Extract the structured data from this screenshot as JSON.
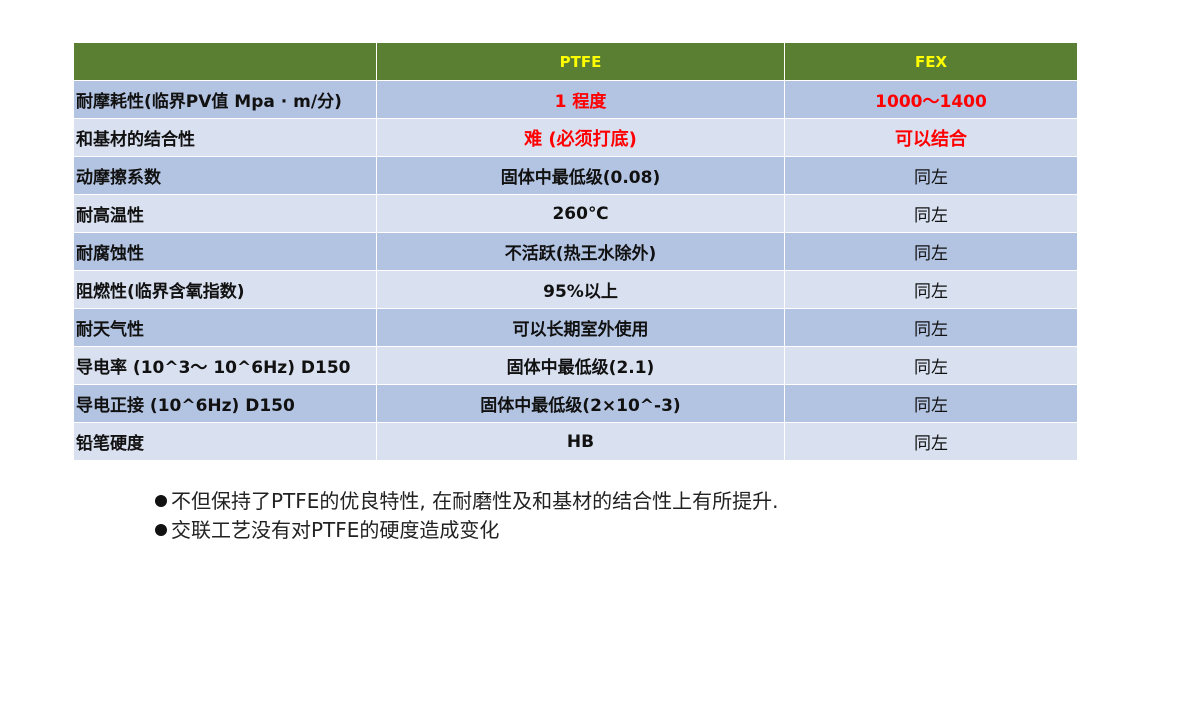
{
  "table": {
    "header": {
      "property": "",
      "ptfe": "PTFE",
      "fex": "FEX"
    },
    "rows": [
      {
        "property": "耐摩耗性(临界PV值 Mpa · m/分)",
        "ptfe": "1 程度",
        "fex": "1000～1400"
      },
      {
        "property": "和基材的结合性",
        "ptfe": "难 (必须打底)",
        "fex": "可以结合"
      },
      {
        "property": "动摩擦系数",
        "ptfe": "固体中最低级(0.08)",
        "fex": "同左"
      },
      {
        "property": "耐高温性",
        "ptfe": "260℃",
        "fex": "同左"
      },
      {
        "property": "耐腐蚀性",
        "ptfe": "不活跃(热王水除外)",
        "fex": "同左"
      },
      {
        "property": "阻燃性(临界含氧指数)",
        "ptfe": "95%以上",
        "fex": "同左"
      },
      {
        "property": "耐天气性",
        "ptfe": "可以长期室外使用",
        "fex": "同左"
      },
      {
        "property": "导电率 (10^3～ 10^6Hz) D150",
        "ptfe": "固体中最低级(2.1)",
        "fex": "同左"
      },
      {
        "property": "导电正接 (10^6Hz) D150",
        "ptfe": "固体中最低级(2×10^-3)",
        "fex": "同左"
      },
      {
        "property": "铅笔硬度",
        "ptfe": "HB",
        "fex": "同左"
      }
    ]
  },
  "notes": [
    "不但保持了PTFE的优良特性, 在耐磨性及和基材的结合性上有所提升.",
    "交联工艺没有对PTFE的硬度造成变化"
  ],
  "colors": {
    "header_bg": "#5a7f33",
    "header_text": "#ffff00",
    "row_dark": "#b3c4e2",
    "row_light": "#d9e1f1",
    "highlight_red": "#ff0000"
  }
}
